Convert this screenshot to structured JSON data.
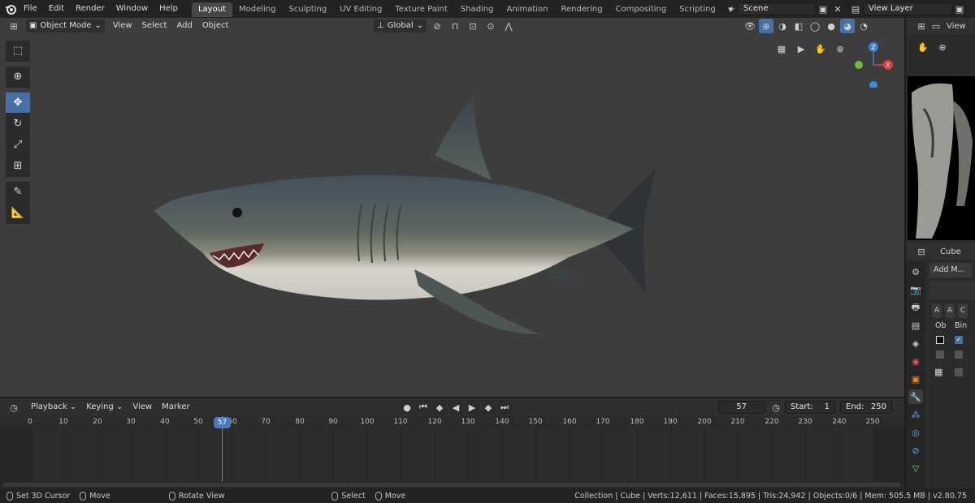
{
  "topbar": {
    "menus": [
      "File",
      "Edit",
      "Render",
      "Window",
      "Help"
    ],
    "workspaces": [
      "Layout",
      "Modeling",
      "Sculpting",
      "UV Editing",
      "Texture Paint",
      "Shading",
      "Animation",
      "Rendering",
      "Compositing",
      "Scripting"
    ],
    "active_workspace": "Layout",
    "add_tab": "+",
    "scene": "Scene",
    "view_layer": "View Layer"
  },
  "viewport_header": {
    "mode": "Object Mode",
    "menus": [
      "View",
      "Select",
      "Add",
      "Object"
    ],
    "transform_orientation": "Global"
  },
  "gizmo": {
    "z_label": "Z",
    "x_label": "X"
  },
  "right_panel": {
    "header_view": "View",
    "properties_object": "Cube",
    "add_modifier": "Add M...",
    "letters": [
      "A",
      "A",
      "C"
    ],
    "col_labels": [
      "Ob",
      "Bin"
    ]
  },
  "timeline": {
    "menus": [
      "Playback",
      "Keying",
      "View",
      "Marker"
    ],
    "current_frame": "57",
    "start_label": "Start:",
    "start_value": "1",
    "end_label": "End:",
    "end_value": "250",
    "ruler": [
      "0",
      "10",
      "20",
      "30",
      "40",
      "50",
      "60",
      "70",
      "80",
      "90",
      "100",
      "110",
      "120",
      "130",
      "140",
      "150",
      "160",
      "170",
      "180",
      "190",
      "200",
      "210",
      "220",
      "230",
      "240",
      "250"
    ],
    "playhead": "57"
  },
  "statusbar": {
    "hints": [
      "Set 3D Cursor",
      "Move",
      "Rotate View",
      "Select",
      "Move"
    ],
    "info": "Collection | Cube | Verts:12,611 | Faces:15,895 | Tris:24,942 | Objects:0/6 | Mem: 505.5 MB | v2.80.75"
  }
}
